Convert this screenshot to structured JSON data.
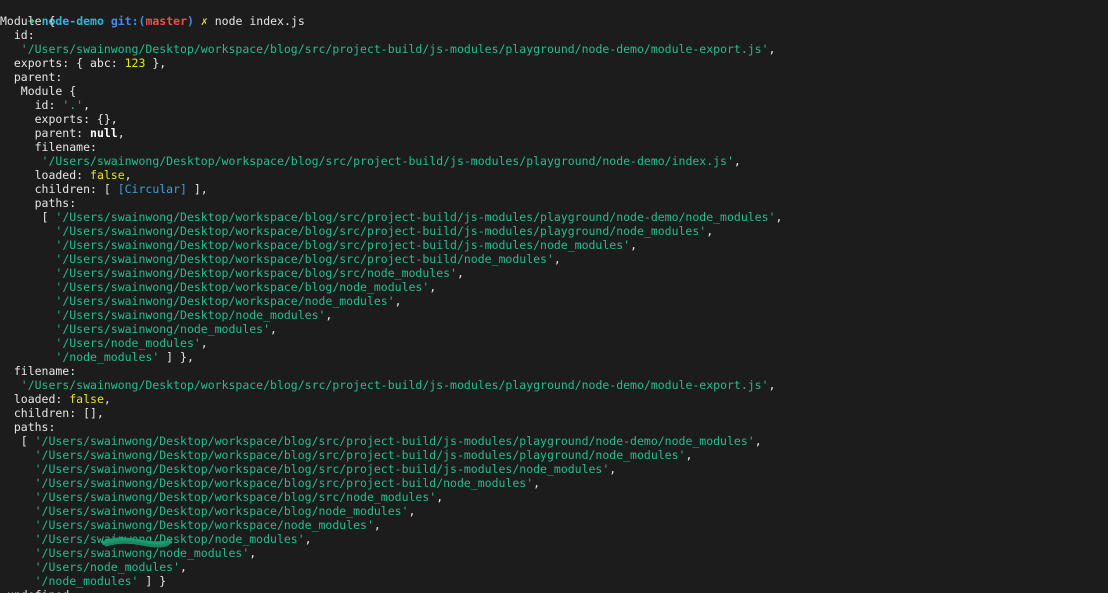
{
  "prompt": {
    "arrow": "➜",
    "dir": "node-demo",
    "git_label": "git:(",
    "branch": "master",
    "git_close": ")",
    "dirty": "✗",
    "command": "node index.js"
  },
  "output_lines": [
    [
      [
        "d",
        "Module {"
      ]
    ],
    [
      [
        "d",
        "  id:"
      ]
    ],
    [
      [
        "d",
        "   "
      ],
      [
        "s",
        "'/Users/swainwong/Desktop/workspace/blog/src/project-build/js-modules/playground/node-demo/module-export.js'"
      ],
      [
        "d",
        ","
      ]
    ],
    [
      [
        "d",
        "  exports: { abc: "
      ],
      [
        "n",
        "123"
      ],
      [
        "d",
        " },"
      ]
    ],
    [
      [
        "d",
        "  parent:"
      ]
    ],
    [
      [
        "d",
        "   Module {"
      ]
    ],
    [
      [
        "d",
        "     id: "
      ],
      [
        "s",
        "'.'"
      ],
      [
        "d",
        ","
      ]
    ],
    [
      [
        "d",
        "     exports: {},"
      ]
    ],
    [
      [
        "d",
        "     parent: "
      ],
      [
        "k",
        "null"
      ],
      [
        "d",
        ","
      ]
    ],
    [
      [
        "d",
        "     filename:"
      ]
    ],
    [
      [
        "d",
        "      "
      ],
      [
        "s",
        "'/Users/swainwong/Desktop/workspace/blog/src/project-build/js-modules/playground/node-demo/index.js'"
      ],
      [
        "d",
        ","
      ]
    ],
    [
      [
        "d",
        "     loaded: "
      ],
      [
        "b",
        "false"
      ],
      [
        "d",
        ","
      ]
    ],
    [
      [
        "d",
        "     children: [ "
      ],
      [
        "c",
        "[Circular]"
      ],
      [
        "d",
        " ],"
      ]
    ],
    [
      [
        "d",
        "     paths:"
      ]
    ],
    [
      [
        "d",
        "      [ "
      ],
      [
        "s",
        "'/Users/swainwong/Desktop/workspace/blog/src/project-build/js-modules/playground/node-demo/node_modules'"
      ],
      [
        "d",
        ","
      ]
    ],
    [
      [
        "d",
        "        "
      ],
      [
        "s",
        "'/Users/swainwong/Desktop/workspace/blog/src/project-build/js-modules/playground/node_modules'"
      ],
      [
        "d",
        ","
      ]
    ],
    [
      [
        "d",
        "        "
      ],
      [
        "s",
        "'/Users/swainwong/Desktop/workspace/blog/src/project-build/js-modules/node_modules'"
      ],
      [
        "d",
        ","
      ]
    ],
    [
      [
        "d",
        "        "
      ],
      [
        "s",
        "'/Users/swainwong/Desktop/workspace/blog/src/project-build/node_modules'"
      ],
      [
        "d",
        ","
      ]
    ],
    [
      [
        "d",
        "        "
      ],
      [
        "s",
        "'/Users/swainwong/Desktop/workspace/blog/src/node_modules'"
      ],
      [
        "d",
        ","
      ]
    ],
    [
      [
        "d",
        "        "
      ],
      [
        "s",
        "'/Users/swainwong/Desktop/workspace/blog/node_modules'"
      ],
      [
        "d",
        ","
      ]
    ],
    [
      [
        "d",
        "        "
      ],
      [
        "s",
        "'/Users/swainwong/Desktop/workspace/node_modules'"
      ],
      [
        "d",
        ","
      ]
    ],
    [
      [
        "d",
        "        "
      ],
      [
        "s",
        "'/Users/swainwong/Desktop/node_modules'"
      ],
      [
        "d",
        ","
      ]
    ],
    [
      [
        "d",
        "        "
      ],
      [
        "s",
        "'/Users/swainwong/node_modules'"
      ],
      [
        "d",
        ","
      ]
    ],
    [
      [
        "d",
        "        "
      ],
      [
        "s",
        "'/Users/node_modules'"
      ],
      [
        "d",
        ","
      ]
    ],
    [
      [
        "d",
        "        "
      ],
      [
        "s",
        "'/node_modules'"
      ],
      [
        "d",
        " ] },"
      ]
    ],
    [
      [
        "d",
        "  filename:"
      ]
    ],
    [
      [
        "d",
        "   "
      ],
      [
        "s",
        "'/Users/swainwong/Desktop/workspace/blog/src/project-build/js-modules/playground/node-demo/module-export.js'"
      ],
      [
        "d",
        ","
      ]
    ],
    [
      [
        "d",
        "  loaded: "
      ],
      [
        "b",
        "false"
      ],
      [
        "d",
        ","
      ]
    ],
    [
      [
        "d",
        "  children: [],"
      ]
    ],
    [
      [
        "d",
        "  paths:"
      ]
    ],
    [
      [
        "d",
        "   [ "
      ],
      [
        "s",
        "'/Users/swainwong/Desktop/workspace/blog/src/project-build/js-modules/playground/node-demo/node_modules'"
      ],
      [
        "d",
        ","
      ]
    ],
    [
      [
        "d",
        "     "
      ],
      [
        "s",
        "'/Users/swainwong/Desktop/workspace/blog/src/project-build/js-modules/playground/node_modules'"
      ],
      [
        "d",
        ","
      ]
    ],
    [
      [
        "d",
        "     "
      ],
      [
        "s",
        "'/Users/swainwong/Desktop/workspace/blog/src/project-build/js-modules/node_modules'"
      ],
      [
        "d",
        ","
      ]
    ],
    [
      [
        "d",
        "     "
      ],
      [
        "s",
        "'/Users/swainwong/Desktop/workspace/blog/src/project-build/node_modules'"
      ],
      [
        "d",
        ","
      ]
    ],
    [
      [
        "d",
        "     "
      ],
      [
        "s",
        "'/Users/swainwong/Desktop/workspace/blog/src/node_modules'"
      ],
      [
        "d",
        ","
      ]
    ],
    [
      [
        "d",
        "     "
      ],
      [
        "s",
        "'/Users/swainwong/Desktop/workspace/blog/node_modules'"
      ],
      [
        "d",
        ","
      ]
    ],
    [
      [
        "d",
        "     "
      ],
      [
        "s",
        "'/Users/swainwong/Desktop/workspace/node_modules'"
      ],
      [
        "d",
        ","
      ]
    ],
    [
      [
        "d",
        "     "
      ],
      [
        "s",
        "'/Users/swainwong/Desktop/node_modules'"
      ],
      [
        "d",
        ","
      ]
    ],
    [
      [
        "d",
        "     "
      ],
      [
        "s",
        "'/Users/swainwong/node_modules'"
      ],
      [
        "d",
        ","
      ]
    ],
    [
      [
        "d",
        "     "
      ],
      [
        "s",
        "'/Users/node_modules'"
      ],
      [
        "d",
        ","
      ]
    ],
    [
      [
        "d",
        "     "
      ],
      [
        "s",
        "'/node_modules'"
      ],
      [
        "d",
        " ] }"
      ]
    ],
    [
      [
        "d",
        " "
      ],
      [
        "u",
        "undefined"
      ]
    ]
  ],
  "colors": {
    "background": "#1c1c1c",
    "default_text": "#e6e6e6",
    "string": "#1fbf8f",
    "number_boolean": "#e5e510",
    "circular": "#3ba0d8",
    "prompt_arrow": "#23d18b",
    "dir": "#29b8db",
    "branch": "#f14c4c",
    "redaction_scribble": "#1a9b6f"
  }
}
